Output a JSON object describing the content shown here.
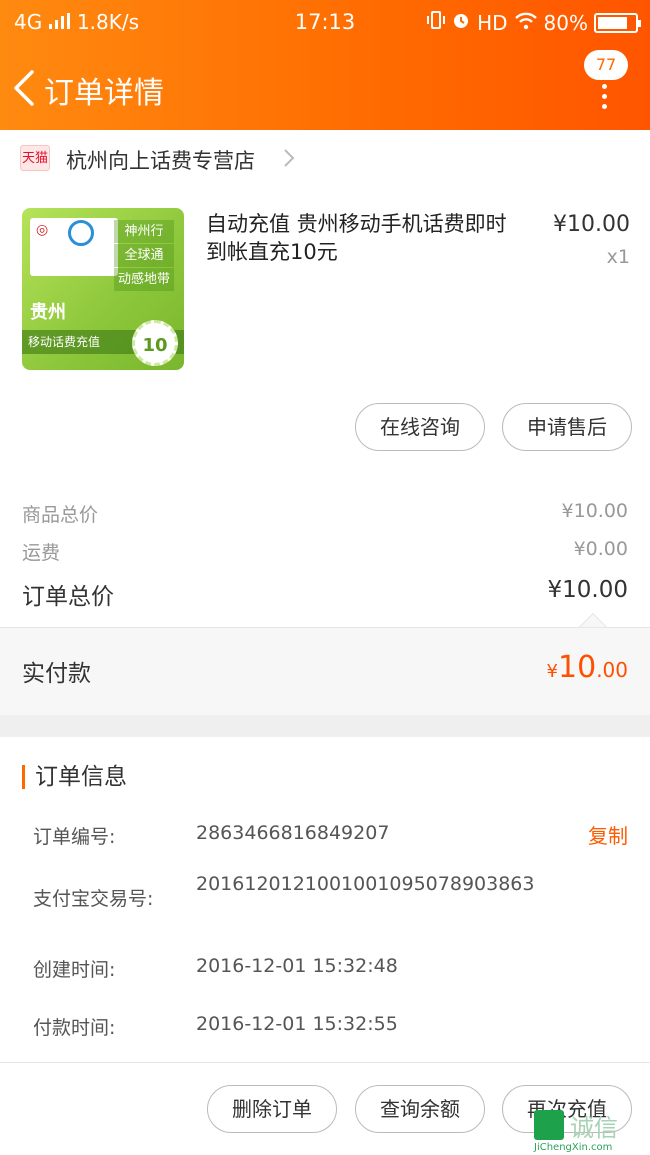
{
  "status_bar": {
    "network": "4G",
    "speed": "1.8K/s",
    "time": "17:13",
    "hd": "HD",
    "battery": "80%",
    "battery_level": 0.8
  },
  "header": {
    "title": "订单详情",
    "badge": "77",
    "accent_color": "#ff6a00"
  },
  "shop": {
    "badge": "天猫",
    "name": "杭州向上话费专营店"
  },
  "product": {
    "title": "自动充值 贵州移动手机话费即时到帐直充10元",
    "price": "¥10.00",
    "qty": "x1",
    "image": {
      "tags": [
        "神州行",
        "全球通",
        "动感地带"
      ],
      "province": "贵州",
      "subtitle": "移动话费充值",
      "face_value": "10"
    }
  },
  "actions_top": {
    "consult": "在线咨询",
    "aftersale": "申请售后"
  },
  "summary": {
    "goods_label": "商品总价",
    "goods_value": "¥10.00",
    "shipping_label": "运费",
    "shipping_value": "¥0.00",
    "total_label": "订单总价",
    "total_value": "¥10.00",
    "paid_label": "实付款",
    "paid_currency": "¥",
    "paid_int": "10",
    "paid_dec": ".00"
  },
  "order_info": {
    "heading": "订单信息",
    "order_no_label": "订单编号:",
    "order_no": "2863466816849207",
    "copy": "复制",
    "alipay_label": "支付宝交易号:",
    "alipay_no": "2016120121001001095078903863",
    "created_label": "创建时间:",
    "created": "2016-12-01 15:32:48",
    "paid_label": "付款时间:",
    "paid": "2016-12-01 15:32:55"
  },
  "actions_bottom": {
    "delete": "删除订单",
    "balance": "查询余额",
    "recharge": "再次充值"
  },
  "watermark": {
    "cn": "诚信",
    "en": "JiChengXin.com"
  }
}
